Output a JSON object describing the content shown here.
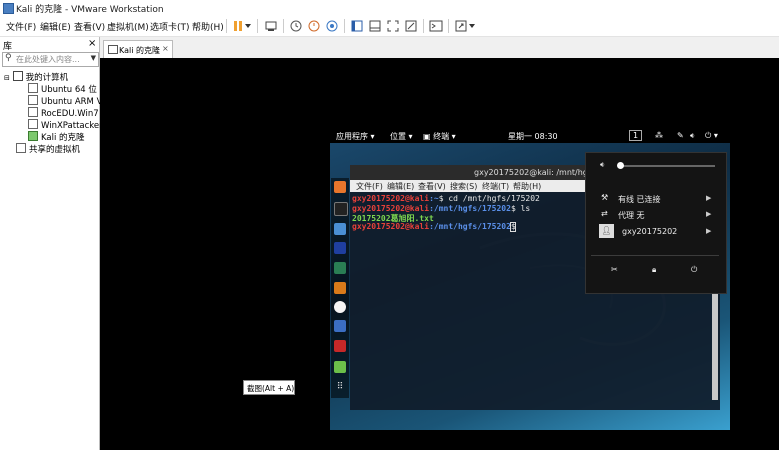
{
  "window": {
    "title": "Kali 的克隆 - VMware Workstation"
  },
  "menu": [
    "文件(F)",
    "编辑(E)",
    "查看(V)",
    "虚拟机(M)",
    "选项卡(T)",
    "帮助(H)"
  ],
  "colors": {
    "accent": "#f0a030",
    "terminal_prompt": "#e8413a",
    "terminal_path": "#5a8fe8",
    "terminal_file": "#7fd84f"
  },
  "library": {
    "title": "库",
    "close": "×",
    "search_placeholder": "在此处键入内容...",
    "items": [
      "我的计算机",
      "Ubuntu 64 位",
      "Ubuntu ARM V1",
      "RocEDU.Win7",
      "WinXPattacker",
      "Kali 的克隆",
      "共享的虚拟机"
    ]
  },
  "tab": {
    "label": "Kali 的克隆",
    "close": "×"
  },
  "kali_topbar": {
    "apps": "应用程序 ▾",
    "places": "位置 ▾",
    "terminal": "终端 ▾",
    "clock": "星期一 08:30",
    "workspace": "1"
  },
  "terminal": {
    "title": "gxy20175202@kali: /mnt/hgfs/175202",
    "menu": [
      "文件(F)",
      "编辑(E)",
      "查看(V)",
      "搜索(S)",
      "终端(T)",
      "帮助(H)"
    ],
    "lines": [
      {
        "prompt": "gxy20175202@kali",
        "path": ":~",
        "cmd": "$ cd /mnt/hgfs/175202"
      },
      {
        "prompt": "gxy20175202@kali",
        "path": ":/mnt/hgfs/175202",
        "cmd": "$ ls"
      },
      {
        "output": "20175202葛旭阳.txt"
      },
      {
        "prompt": "gxy20175202@kali",
        "path": ":/mnt/hgfs/175202",
        "cmd": "$ "
      }
    ]
  },
  "system_menu": {
    "wired": "有线 已连接",
    "proxy": "代理 无",
    "user": "gxy20175202"
  },
  "tooltip": "截图(Alt + A)"
}
